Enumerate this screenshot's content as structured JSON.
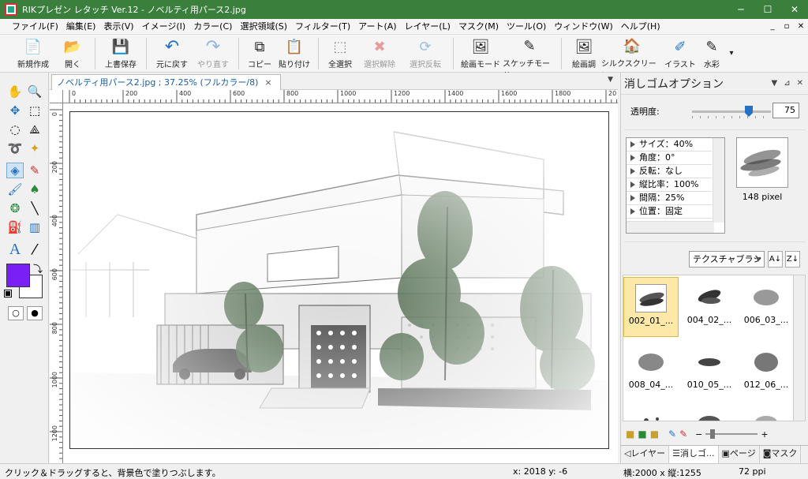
{
  "window": {
    "title": "RIKプレゼン レタッチ Ver.12 - ノベルティ用パース2.jpg",
    "minimize": "─",
    "maximize": "☐",
    "close": "✕"
  },
  "menu": [
    "ファイル(F)",
    "編集(E)",
    "表示(V)",
    "イメージ(I)",
    "カラー(C)",
    "選択領域(S)",
    "フィルター(T)",
    "アート(A)",
    "レイヤー(L)",
    "マスク(M)",
    "ツール(O)",
    "ウィンドウ(W)",
    "ヘルプ(H)"
  ],
  "mdi_controls": [
    "_",
    "▫",
    "✕"
  ],
  "toolbar": [
    {
      "label": "新規作成",
      "icon": "new-document-icon",
      "glyph": "📄",
      "disabled": false
    },
    {
      "label": "開く",
      "icon": "folder-open-icon",
      "glyph": "📂",
      "disabled": false
    },
    {
      "label": "上書保存",
      "icon": "save-icon",
      "glyph": "💾",
      "disabled": false
    },
    {
      "label": "元に戻す",
      "icon": "undo-icon",
      "glyph": "↶",
      "disabled": false
    },
    {
      "label": "やり直す",
      "icon": "redo-icon",
      "glyph": "↷",
      "disabled": true
    },
    {
      "label": "コピー",
      "icon": "copy-icon",
      "glyph": "⧉",
      "disabled": false
    },
    {
      "label": "貼り付け",
      "icon": "paste-icon",
      "glyph": "📋",
      "disabled": false
    },
    {
      "label": "全選択",
      "icon": "select-all-icon",
      "glyph": "⬚",
      "disabled": false
    },
    {
      "label": "選択解除",
      "icon": "deselect-icon",
      "glyph": "✖",
      "disabled": true
    },
    {
      "label": "選択反転",
      "icon": "invert-selection-icon",
      "glyph": "⟳",
      "disabled": true
    },
    {
      "label": "絵画モード",
      "icon": "painting-mode-icon",
      "glyph": "🖼",
      "disabled": false
    },
    {
      "label": "スケッチモード",
      "icon": "sketch-mode-icon",
      "glyph": "✎",
      "disabled": false
    },
    {
      "label": "絵画調",
      "icon": "painting-style-icon",
      "glyph": "🖼",
      "disabled": false
    },
    {
      "label": "シルクスクリーン",
      "icon": "silkscreen-icon",
      "glyph": "🏠",
      "disabled": false
    },
    {
      "label": "イラスト",
      "icon": "illustration-icon",
      "glyph": "✐",
      "disabled": false
    },
    {
      "label": "水彩",
      "icon": "watercolor-icon",
      "glyph": "✎",
      "disabled": false
    }
  ],
  "toolbar_more": "▾",
  "document": {
    "tab_label": "ノベルティ用パース2.jpg ; 37.25% (フルカラー/8)",
    "tab_close": "×",
    "tabs_dropdown": "▼",
    "h_ruler": [
      "0",
      "200",
      "400",
      "600",
      "800",
      "1000",
      "1200",
      "1400",
      "1600",
      "1800",
      "20"
    ],
    "v_ruler": [
      "0",
      "200",
      "400",
      "600",
      "800",
      "1000",
      "1200"
    ]
  },
  "tools": [
    {
      "name": "hand-icon",
      "glyph": "✋"
    },
    {
      "name": "zoom-icon",
      "glyph": "🔍"
    },
    {
      "name": "move-icon",
      "glyph": "✥"
    },
    {
      "name": "rect-select-icon",
      "glyph": "⬚"
    },
    {
      "name": "ellipse-select-icon",
      "glyph": "◌"
    },
    {
      "name": "polygon-select-icon",
      "glyph": "⟁"
    },
    {
      "name": "lasso-icon",
      "glyph": "➰"
    },
    {
      "name": "magic-wand-icon",
      "glyph": "✦"
    },
    {
      "name": "eraser-icon",
      "glyph": "◈"
    },
    {
      "name": "pen-icon",
      "glyph": "✎"
    },
    {
      "name": "brush-icon",
      "glyph": "🖌"
    },
    {
      "name": "leaf-brush-icon",
      "glyph": "♠"
    },
    {
      "name": "stamp-icon",
      "glyph": "❂"
    },
    {
      "name": "line-icon",
      "glyph": "╲"
    },
    {
      "name": "fill-bucket-icon",
      "glyph": "⛽"
    },
    {
      "name": "gradient-icon",
      "glyph": "▥"
    },
    {
      "name": "text-icon",
      "glyph": "A"
    },
    {
      "name": "eyedropper-icon",
      "glyph": "⁄"
    }
  ],
  "colors": {
    "foreground": "#7a1ff5",
    "background": "#ffffff",
    "accent": "#2372c6",
    "titlebar": "#3a7f3c",
    "selected_cell": "#fde8a8"
  },
  "swap_colors_icon": "⤵",
  "mask_modes": [
    "○",
    "●"
  ],
  "panel": {
    "title": "消しゴムオプション",
    "title_controls": [
      "▼",
      "⊿",
      "✕"
    ],
    "opacity_label": "透明度:",
    "opacity_value": "75",
    "opacity_fraction": 0.72,
    "properties": [
      "サイズ：40%",
      "角度：0°",
      "反転：なし",
      "縦比率：100%",
      "間隔：25%",
      "位置：固定"
    ],
    "brush_size": "148 pixel",
    "brush_type": "テクスチャブラシ",
    "sort_buttons": [
      "A↓",
      "Z↓"
    ],
    "brushes": [
      "002_01_...",
      "004_02_...",
      "006_03_...",
      "008_04_...",
      "010_05_...",
      "012_06_..."
    ],
    "bottom_minus": "−",
    "bottom_plus": "+",
    "tabs": [
      "レイヤー",
      "消しゴ...",
      "ページ",
      "マスク"
    ]
  },
  "status": {
    "hint": "クリック＆ドラッグすると、背景色で塗りつぶします。",
    "coords": "x: 2018 y: -6",
    "dimensions": "横:2000 x 縦:1255",
    "resolution": "72 ppi"
  }
}
